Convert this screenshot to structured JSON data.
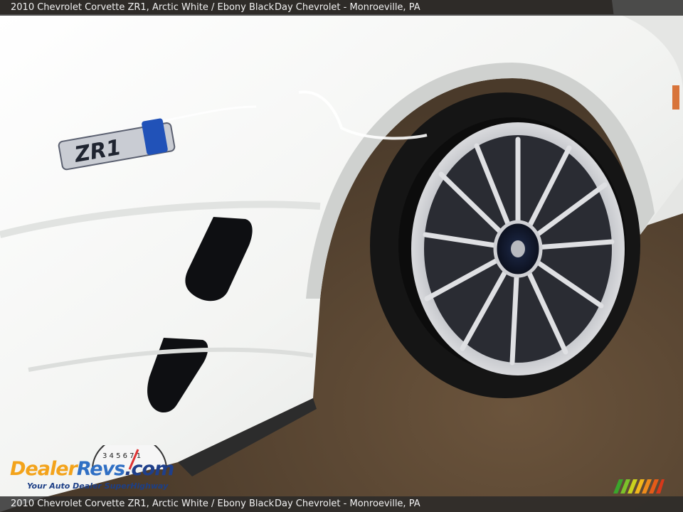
{
  "caption": {
    "vehicle": "2010 Chevrolet Corvette ZR1,  Arctic White / Ebony Black",
    "dealer": "Day Chevrolet - Monroeville, PA"
  },
  "watermark": {
    "brand_dealer": "Dealer",
    "brand_revs": "Revs",
    "brand_com": ".com",
    "tagline": "Your Auto Dealer SuperHighway",
    "gauge_digits": "3 4 5 6 7 1"
  },
  "badge": {
    "text": "ZR1"
  },
  "colors": {
    "paint": "#f4f5f3",
    "tire": "#151515",
    "floor": "#5a4632",
    "logo_orange": "#f3a31b",
    "logo_blue": "#2f6fc4"
  }
}
